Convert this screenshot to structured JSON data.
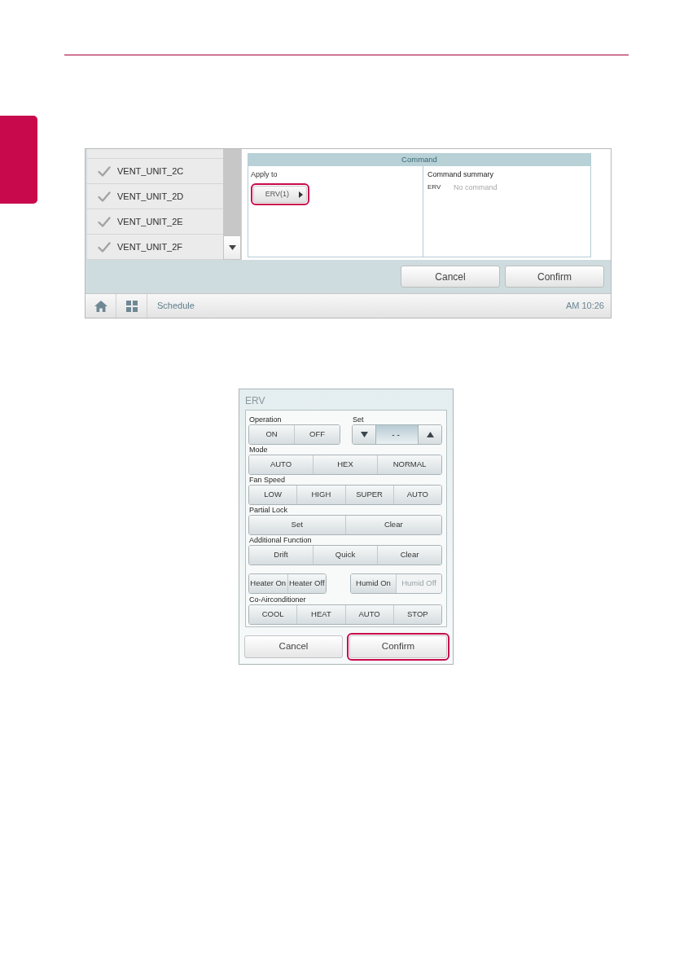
{
  "screen": {
    "device_list": {
      "items": [
        {
          "label": "VENT_UNIT_2C",
          "checked": true
        },
        {
          "label": "VENT_UNIT_2D",
          "checked": true
        },
        {
          "label": "VENT_UNIT_2E",
          "checked": true
        },
        {
          "label": "VENT_UNIT_2F",
          "checked": true
        }
      ]
    },
    "command": {
      "title": "Command",
      "apply_to": {
        "label": "Apply to",
        "button": {
          "label": "ERV(1)",
          "highlighted": true
        }
      },
      "summary": {
        "label": "Command summary",
        "rows": [
          {
            "device": "ERV",
            "command": "No command"
          }
        ]
      }
    },
    "buttons": [
      {
        "label": "Cancel",
        "highlighted": false
      },
      {
        "label": "Confirm",
        "highlighted": false
      }
    ],
    "bottom_bar": {
      "title": "Schedule",
      "time": "AM 10:26"
    }
  },
  "dialog": {
    "title": "ERV",
    "sections": [
      {
        "kind": "split",
        "left": {
          "label": "Operation",
          "buttons": [
            {
              "label": "ON"
            },
            {
              "label": "OFF"
            }
          ]
        },
        "right": {
          "label": "Set",
          "value": "--"
        }
      },
      {
        "kind": "group",
        "label": "Mode",
        "buttons": [
          {
            "label": "AUTO"
          },
          {
            "label": "HEX"
          },
          {
            "label": "NORMAL"
          }
        ]
      },
      {
        "kind": "group",
        "label": "Fan Speed",
        "buttons": [
          {
            "label": "LOW"
          },
          {
            "label": "HIGH"
          },
          {
            "label": "SUPER"
          },
          {
            "label": "AUTO"
          }
        ]
      },
      {
        "kind": "group",
        "label": "Partial Lock",
        "buttons": [
          {
            "label": "Set"
          },
          {
            "label": "Clear"
          }
        ]
      },
      {
        "kind": "group",
        "label": "Additional Function",
        "buttons": [
          {
            "label": "Drift"
          },
          {
            "label": "Quick"
          },
          {
            "label": "Clear"
          }
        ]
      },
      {
        "kind": "toggles",
        "groups": [
          {
            "buttons": [
              {
                "label": "Heater On",
                "disabled": false
              },
              {
                "label": "Heater Off",
                "disabled": false
              }
            ]
          },
          {
            "buttons": [
              {
                "label": "Humid On",
                "disabled": false
              },
              {
                "label": "Humid Off",
                "disabled": true
              }
            ]
          }
        ]
      },
      {
        "kind": "group",
        "label": "Co-Airconditioner",
        "buttons": [
          {
            "label": "COOL"
          },
          {
            "label": "HEAT"
          },
          {
            "label": "AUTO"
          },
          {
            "label": "STOP"
          }
        ]
      }
    ],
    "buttons": [
      {
        "label": "Cancel",
        "highlighted": false
      },
      {
        "label": "Confirm",
        "highlighted": true
      }
    ]
  }
}
